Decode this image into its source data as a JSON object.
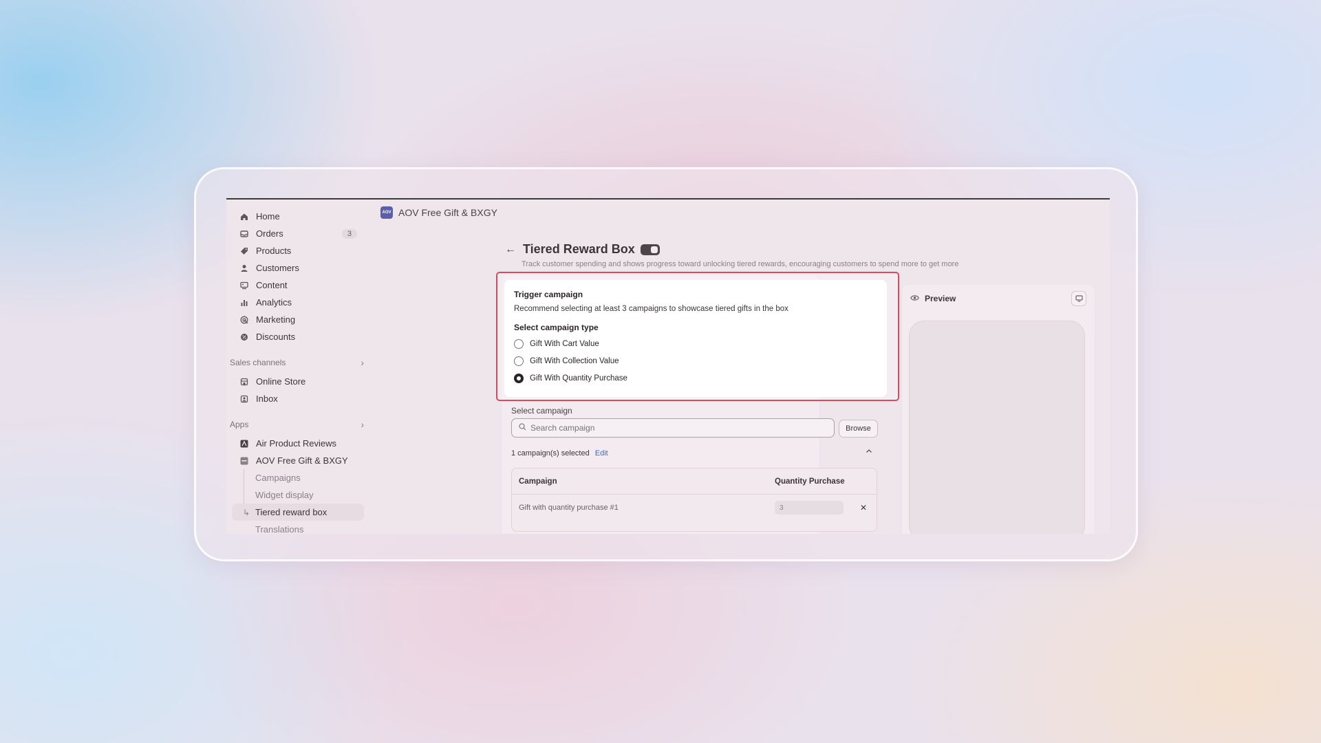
{
  "app": {
    "title": "AOV Free Gift & BXGY",
    "logo_text": "AOV"
  },
  "sidebar": {
    "items": [
      {
        "label": "Home",
        "icon": "home-icon"
      },
      {
        "label": "Orders",
        "icon": "orders-icon",
        "badge": "3"
      },
      {
        "label": "Products",
        "icon": "tag-icon"
      },
      {
        "label": "Customers",
        "icon": "person-icon"
      },
      {
        "label": "Content",
        "icon": "content-icon"
      },
      {
        "label": "Analytics",
        "icon": "bar-chart-icon"
      },
      {
        "label": "Marketing",
        "icon": "target-icon"
      },
      {
        "label": "Discounts",
        "icon": "discount-icon"
      }
    ],
    "sales_channels": {
      "title": "Sales channels",
      "items": [
        {
          "label": "Online Store",
          "icon": "store-icon"
        },
        {
          "label": "Inbox",
          "icon": "inbox-icon"
        }
      ]
    },
    "apps": {
      "title": "Apps",
      "items": [
        {
          "label": "Air Product Reviews",
          "icon": "air-reviews-icon"
        },
        {
          "label": "AOV Free Gift & BXGY",
          "icon": "aov-app-icon"
        }
      ],
      "sub_items": [
        "Campaigns",
        "Widget display",
        "Tiered reward box",
        "Translations"
      ]
    }
  },
  "page": {
    "title": "Tiered Reward Box",
    "subtitle": "Track customer spending and shows progress toward unlocking tiered rewards, encouraging customers to spend more to get more"
  },
  "trigger": {
    "title": "Trigger campaign",
    "description": "Recommend selecting at least 3 campaigns to showcase tiered gifts in the box",
    "type_label": "Select campaign type",
    "options": [
      "Gift With Cart Value",
      "Gift With Collection Value",
      "Gift With Quantity Purchase"
    ],
    "selected_index": 2
  },
  "campaign": {
    "label": "Select campaign",
    "search_placeholder": "Search campaign",
    "browse_label": "Browse",
    "selected_text": "1 campaign(s) selected",
    "edit_label": "Edit",
    "table": {
      "headers": [
        "Campaign",
        "Quantity Purchase"
      ],
      "rows": [
        {
          "campaign": "Gift with quantity purchase #1",
          "quantity": "3"
        }
      ]
    }
  },
  "preview": {
    "title": "Preview"
  },
  "colors": {
    "highlight": "#d84a5c",
    "link": "#4169c7",
    "app_logo": "#5d5ea8"
  }
}
